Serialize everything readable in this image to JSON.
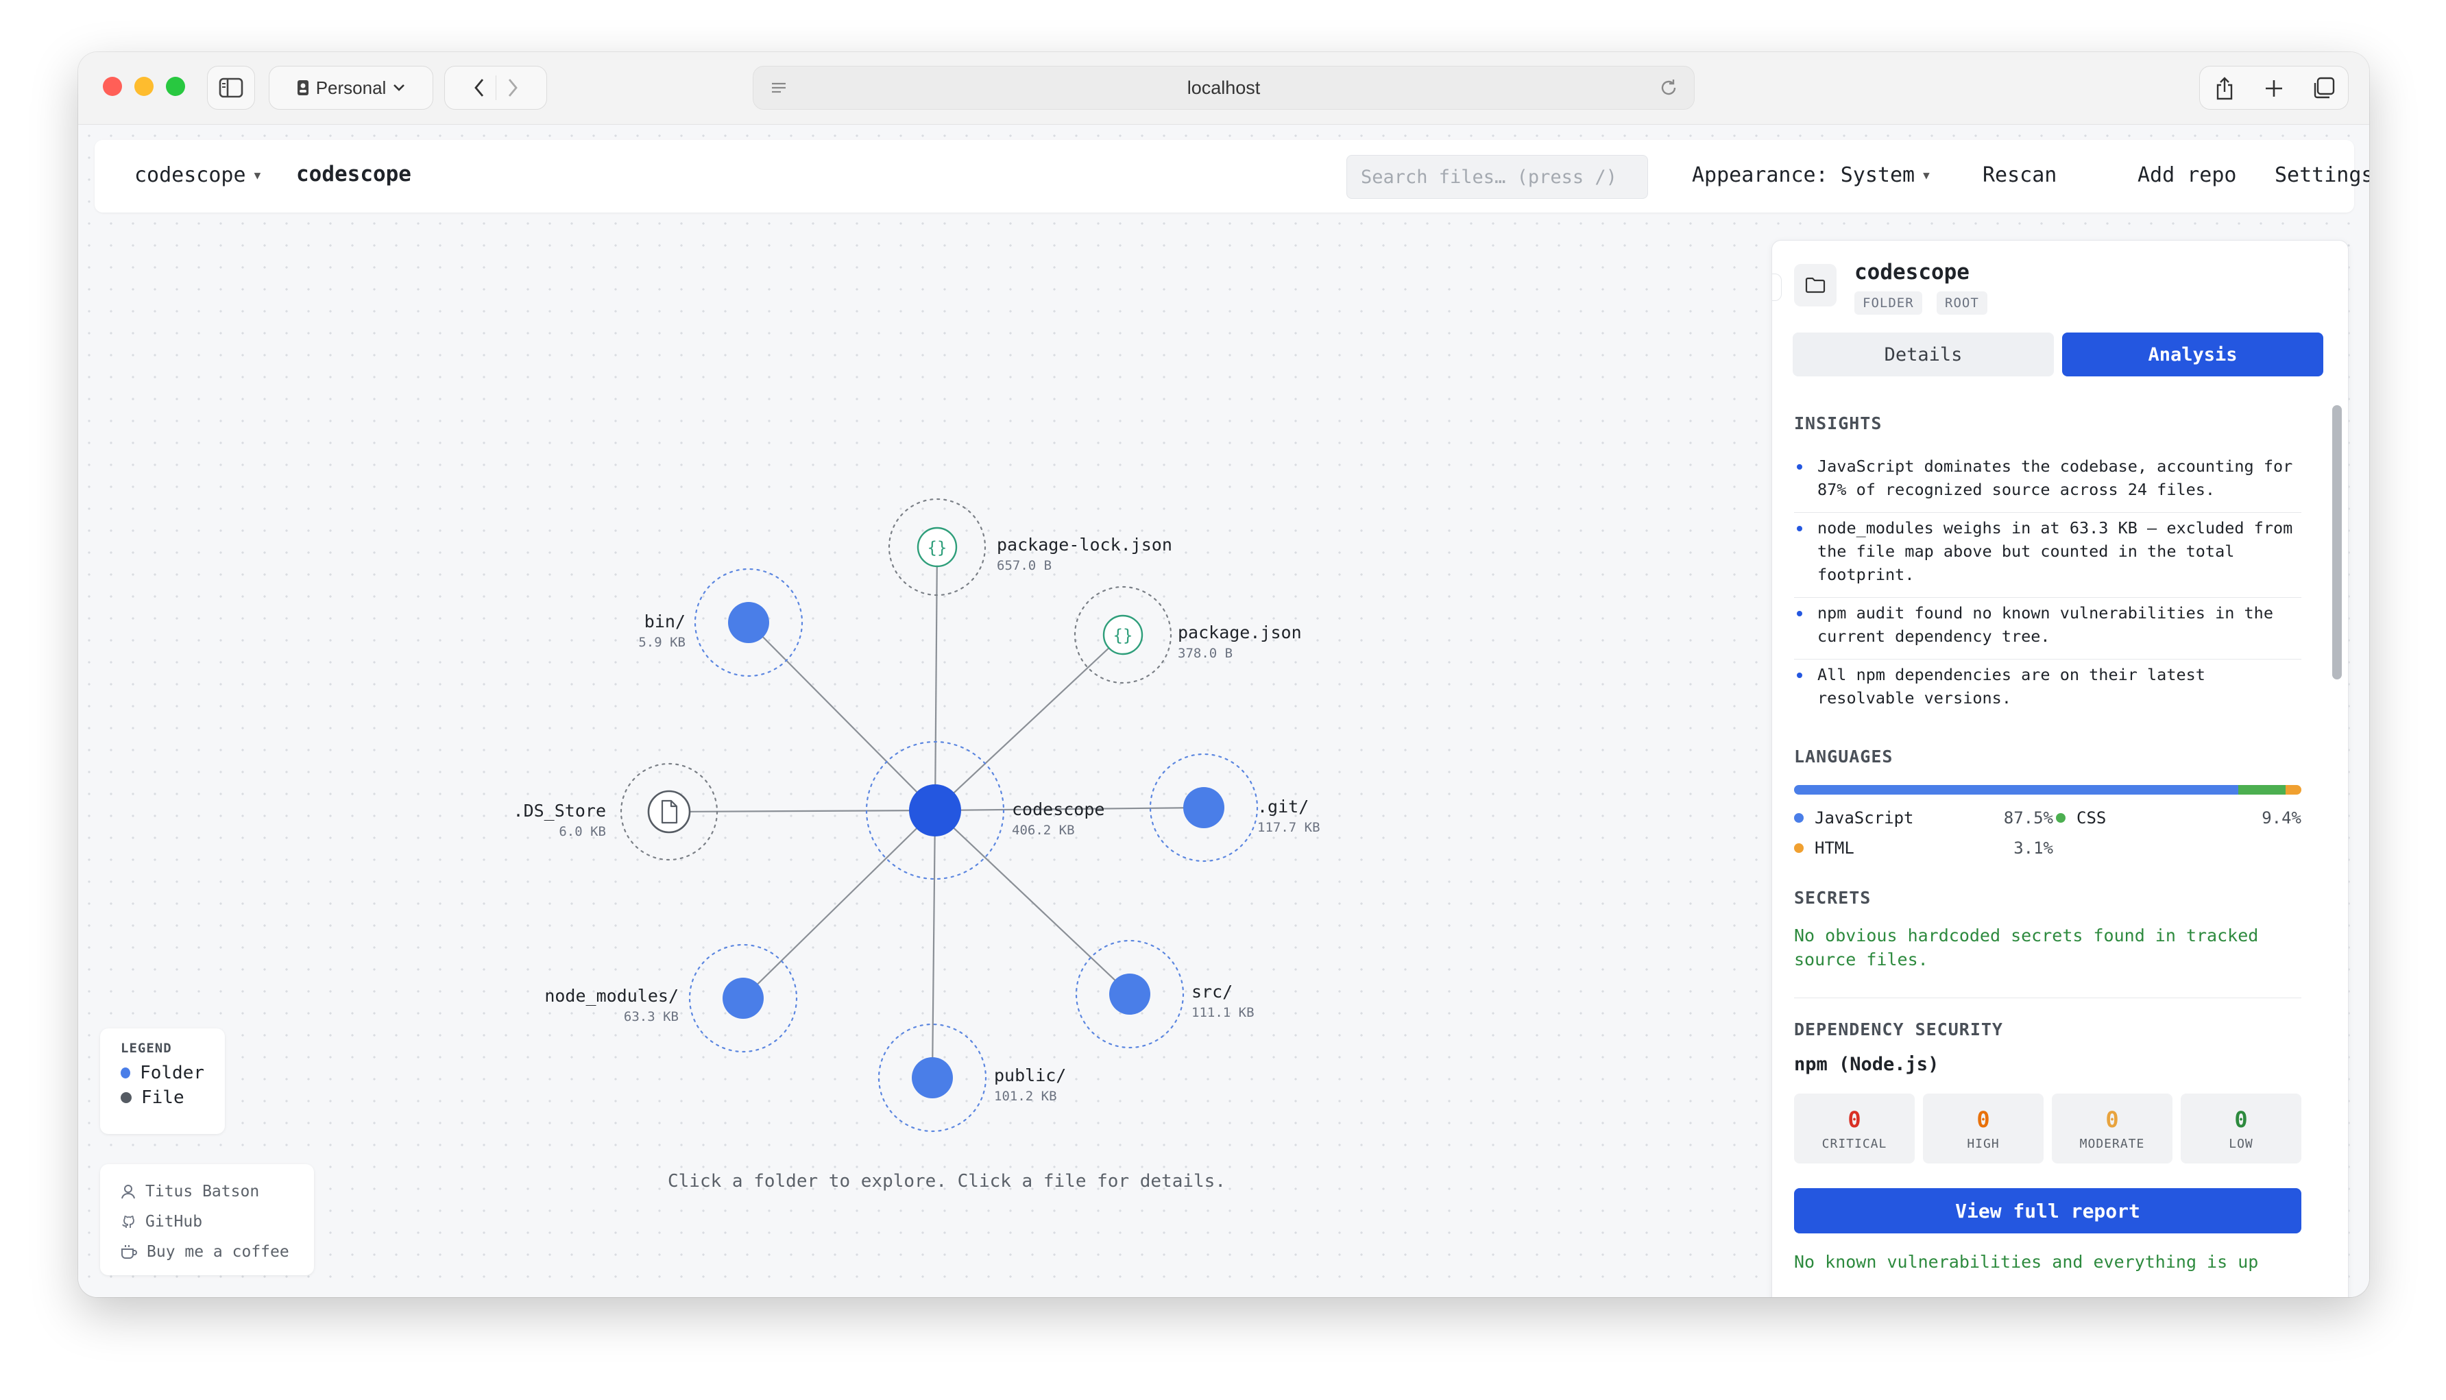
{
  "browser": {
    "profile_label": "Personal",
    "url": "localhost"
  },
  "topbar": {
    "repo_selector": "codescope",
    "repo_title": "codescope",
    "search_placeholder": "Search files… (press /)",
    "appearance_label": "Appearance: System",
    "rescan_label": "Rescan",
    "add_repo_label": "Add repo",
    "settings_label": "Settings"
  },
  "graph": {
    "center": {
      "name": "codescope",
      "size": "406.2 KB"
    },
    "nodes": [
      {
        "name": "package-lock.json",
        "size": "657.0 B",
        "kind": "json"
      },
      {
        "name": "package.json",
        "size": "378.0 B",
        "kind": "json"
      },
      {
        "name": ".git/",
        "size": "117.7 KB",
        "kind": "folder"
      },
      {
        "name": "src/",
        "size": "111.1 KB",
        "kind": "folder"
      },
      {
        "name": "public/",
        "size": "101.2 KB",
        "kind": "folder"
      },
      {
        "name": "node_modules/",
        "size": "63.3 KB",
        "kind": "folder"
      },
      {
        "name": ".DS_Store",
        "size": "6.0 KB",
        "kind": "file"
      },
      {
        "name": "bin/",
        "size": "5.9 KB",
        "kind": "folder"
      }
    ],
    "hint": "Click a folder to explore. Click a file for details.",
    "colors": {
      "folder": "#4a7ee8",
      "center": "#2457e0",
      "json": "#2e9e7a",
      "file": "#555b63",
      "edge": "#8a8f96",
      "ring": "#5b86e0"
    }
  },
  "legend": {
    "title": "LEGEND",
    "items": [
      {
        "label": "Folder",
        "color": "#4a7ee8"
      },
      {
        "label": "File",
        "color": "#555b63"
      }
    ]
  },
  "credits": {
    "author": "Titus Batson",
    "github": "GitHub",
    "coffee": "Buy me a coffee"
  },
  "panel": {
    "title": "codescope",
    "badges": [
      "FOLDER",
      "ROOT"
    ],
    "tabs": {
      "details": "Details",
      "analysis": "Analysis"
    },
    "insights_title": "INSIGHTS",
    "insights": [
      "JavaScript dominates the codebase, accounting for 87% of recognized source across 24 files.",
      "node_modules weighs in at 63.3 KB – excluded from the file map above but counted in the total footprint.",
      "npm audit found no known vulnerabilities in the current dependency tree.",
      "All npm dependencies are on their latest resolvable versions."
    ],
    "languages_title": "LANGUAGES",
    "languages": [
      {
        "name": "JavaScript",
        "pct": "87.5%",
        "value": 87.5,
        "color": "#4a7ee8"
      },
      {
        "name": "CSS",
        "pct": "9.4%",
        "value": 9.4,
        "color": "#4caf50"
      },
      {
        "name": "HTML",
        "pct": "3.1%",
        "value": 3.1,
        "color": "#f0a030"
      }
    ],
    "secrets_title": "SECRETS",
    "secrets_text": "No obvious hardcoded secrets found in tracked source files.",
    "dep_title": "DEPENDENCY SECURITY",
    "dep_ecosystem": "npm (Node.js)",
    "severity": [
      {
        "label": "CRITICAL",
        "count": "0",
        "color": "#d93025"
      },
      {
        "label": "HIGH",
        "count": "0",
        "color": "#e8710a"
      },
      {
        "label": "MODERATE",
        "count": "0",
        "color": "#e8a33d"
      },
      {
        "label": "LOW",
        "count": "0",
        "color": "#2d8a3e"
      }
    ],
    "report_button": "View full report",
    "footer_text": "No known vulnerabilities and everything is up"
  }
}
